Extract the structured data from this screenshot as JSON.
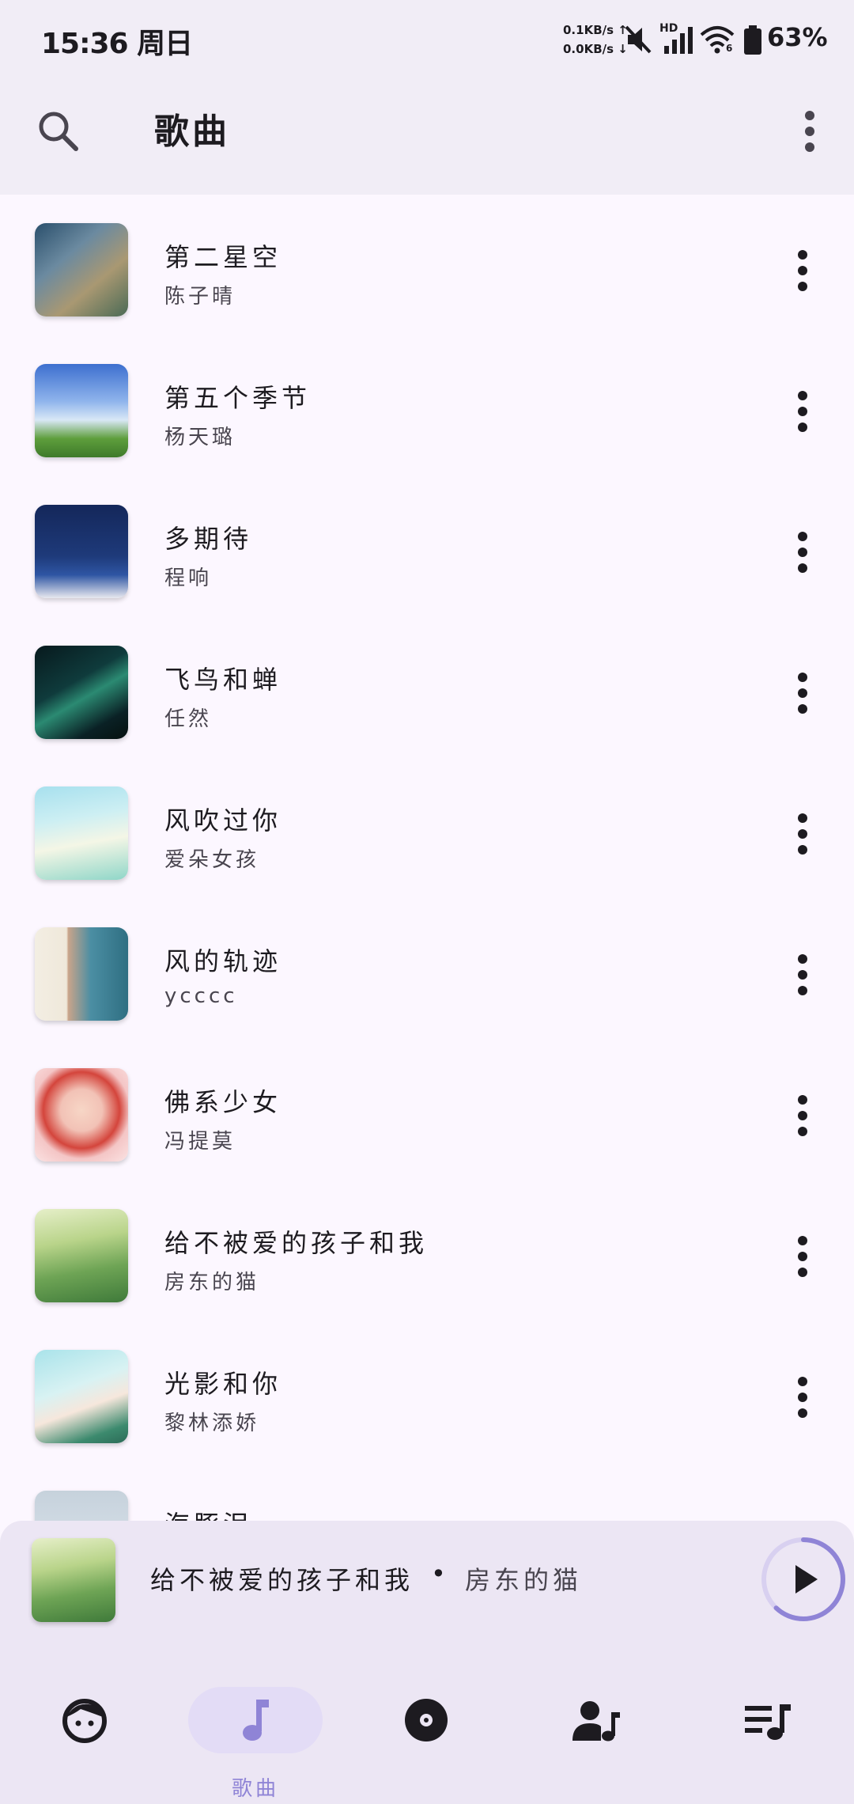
{
  "status_bar": {
    "time": "15:36 周日",
    "net_up": "0.1KB/s ↑",
    "net_down": "0.0KB/s ↓",
    "hd": "HD",
    "wifi_sub": "6",
    "battery": "63%"
  },
  "app_bar": {
    "title": "歌曲"
  },
  "songs": [
    {
      "title": "第二星空",
      "artist": "陈子晴"
    },
    {
      "title": "第五个季节",
      "artist": "杨天璐"
    },
    {
      "title": "多期待",
      "artist": "程响"
    },
    {
      "title": "飞鸟和蝉",
      "artist": "任然"
    },
    {
      "title": "风吹过你",
      "artist": "爱朵女孩"
    },
    {
      "title": "风的轨迹",
      "artist": "ycccc"
    },
    {
      "title": "佛系少女",
      "artist": "冯提莫"
    },
    {
      "title": "给不被爱的孩子和我",
      "artist": "房东的猫"
    },
    {
      "title": "光影和你",
      "artist": "黎林添娇"
    },
    {
      "title": "海豚泪",
      "artist": ""
    }
  ],
  "mini_player": {
    "title": "给不被爱的孩子和我",
    "separator": "•",
    "artist": "房东的猫",
    "progress": 0.62
  },
  "nav": {
    "items": [
      {
        "icon": "face-icon",
        "label": ""
      },
      {
        "icon": "music-note-icon",
        "label": "歌曲"
      },
      {
        "icon": "album-disc-icon",
        "label": ""
      },
      {
        "icon": "artist-icon",
        "label": ""
      },
      {
        "icon": "playlist-icon",
        "label": ""
      }
    ],
    "active_index": 1
  },
  "colors": {
    "accent": "#8f84d6",
    "background": "#fcf7ff",
    "bar": "#f1edf6",
    "nav": "#ece6f4"
  }
}
